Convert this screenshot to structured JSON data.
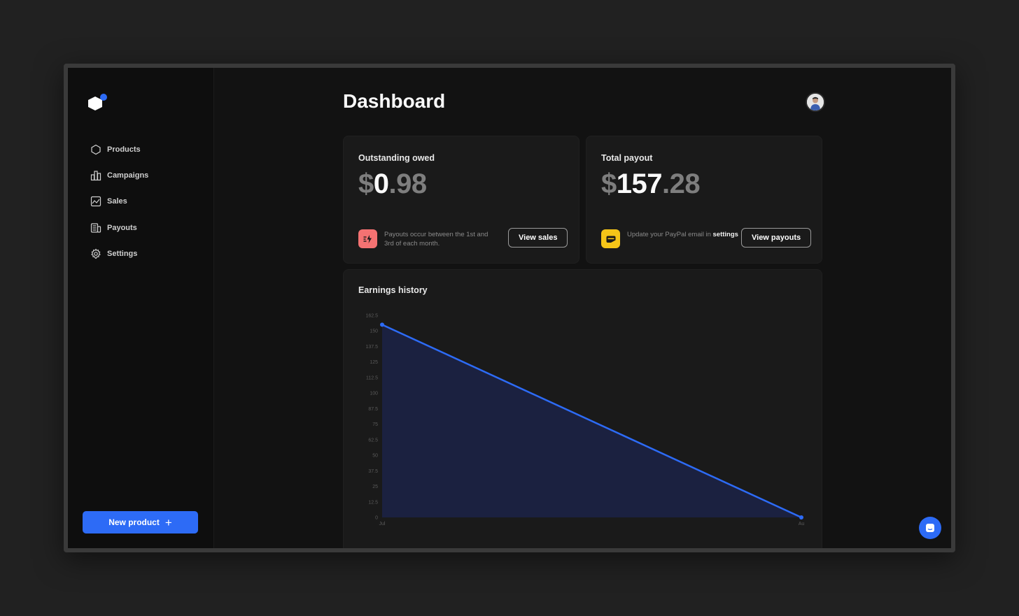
{
  "colors": {
    "accent": "#2d6bf6",
    "background": "#121212",
    "card": "#1a1a1a"
  },
  "sidebar": {
    "items": [
      {
        "label": "Products",
        "icon": "hexagon-icon"
      },
      {
        "label": "Campaigns",
        "icon": "bar-chart-icon"
      },
      {
        "label": "Sales",
        "icon": "line-chart-icon"
      },
      {
        "label": "Payouts",
        "icon": "receipt-icon"
      },
      {
        "label": "Settings",
        "icon": "gear-icon"
      }
    ],
    "new_product_label": "New product"
  },
  "header": {
    "title": "Dashboard"
  },
  "cards": {
    "outstanding": {
      "label": "Outstanding owed",
      "currency": "$",
      "amount_int": "0",
      "amount_dec": ".98",
      "note": "Payouts occur between the 1st and 3rd of each month.",
      "button": "View sales"
    },
    "payout": {
      "label": "Total payout",
      "currency": "$",
      "amount_int": "157",
      "amount_dec": ".28",
      "note": "Update your PayPal email in",
      "note_link": "settings",
      "button": "View payouts"
    }
  },
  "chart_data": {
    "type": "area",
    "title": "Earnings history",
    "x": [
      "Jul",
      "Au"
    ],
    "series": [
      {
        "values": [
          155,
          0
        ]
      }
    ],
    "ylim": [
      0,
      162.5
    ],
    "yticks": [
      "162.5",
      "150",
      "137.5",
      "125",
      "112.5",
      "100",
      "87.5",
      "75",
      "62.5",
      "50",
      "37.5",
      "25",
      "12.5",
      "0"
    ],
    "line_color": "#2d6bf6",
    "fill_color": "#1b2140",
    "grid": false
  }
}
